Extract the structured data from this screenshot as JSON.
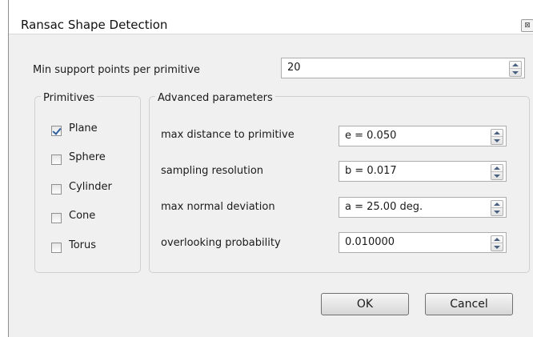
{
  "window": {
    "title": "Ransac Shape Detection",
    "close_glyph": "⊠"
  },
  "min_support": {
    "label": "Min support points per primitive",
    "value": "20"
  },
  "primitives": {
    "title": "Primitives",
    "items": [
      {
        "label": "Plane",
        "checked": true
      },
      {
        "label": "Sphere",
        "checked": false
      },
      {
        "label": "Cylinder",
        "checked": false
      },
      {
        "label": "Cone",
        "checked": false
      },
      {
        "label": "Torus",
        "checked": false
      }
    ]
  },
  "advanced": {
    "title": "Advanced parameters",
    "params": [
      {
        "label": "max distance to primitive",
        "value": "e = 0.050"
      },
      {
        "label": "sampling resolution",
        "value": "b = 0.017"
      },
      {
        "label": "max normal deviation",
        "value": "a = 25.00 deg."
      },
      {
        "label": "overlooking probability",
        "value": "0.010000"
      }
    ]
  },
  "buttons": {
    "ok": "OK",
    "cancel": "Cancel"
  },
  "icons": {
    "close": "close-icon",
    "checkmark": "checkmark-icon",
    "spin": "spin-arrows-icon"
  },
  "colors": {
    "check": "#2c5f9e",
    "titlebar": "#ffffff",
    "dialog": "#f0f0f0"
  }
}
